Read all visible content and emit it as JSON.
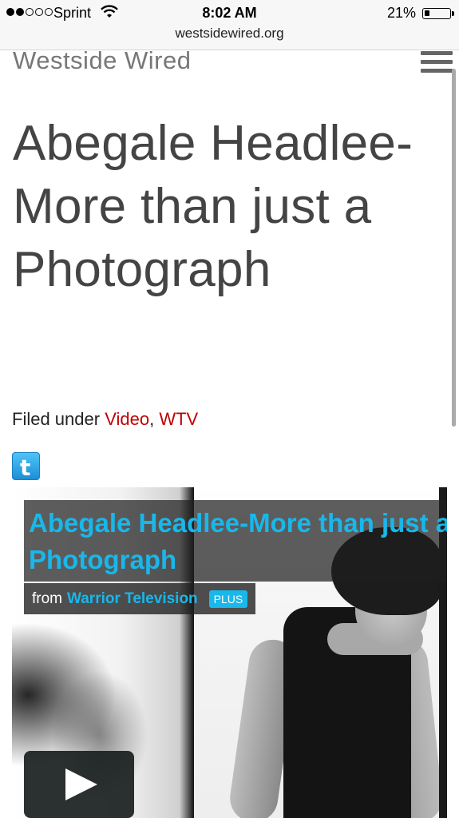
{
  "status_bar": {
    "carrier": "Sprint",
    "time": "8:02 AM",
    "battery_percent": "21%",
    "signal_strength": 2,
    "battery_level": 0.21
  },
  "browser": {
    "url": "westsidewired.org"
  },
  "site": {
    "title": "Westside Wired",
    "menu_icon": "hamburger-menu-icon"
  },
  "article": {
    "headline": "Abegale Headlee-More than just a Photograph",
    "filed_under_label": "Filed under",
    "categories": [
      {
        "label": "Video",
        "color": "#c00000"
      },
      {
        "label": "WTV",
        "color": "#c00000"
      }
    ],
    "share_icon": "twitter-icon",
    "share_glyph": "t"
  },
  "video": {
    "title": "Abegale Headlee-More than just a Photograph",
    "from_label": "from",
    "channel": "Warrior Television",
    "badge": "PLUS",
    "accent_color": "#19b7ea",
    "play_icon": "play-icon"
  }
}
